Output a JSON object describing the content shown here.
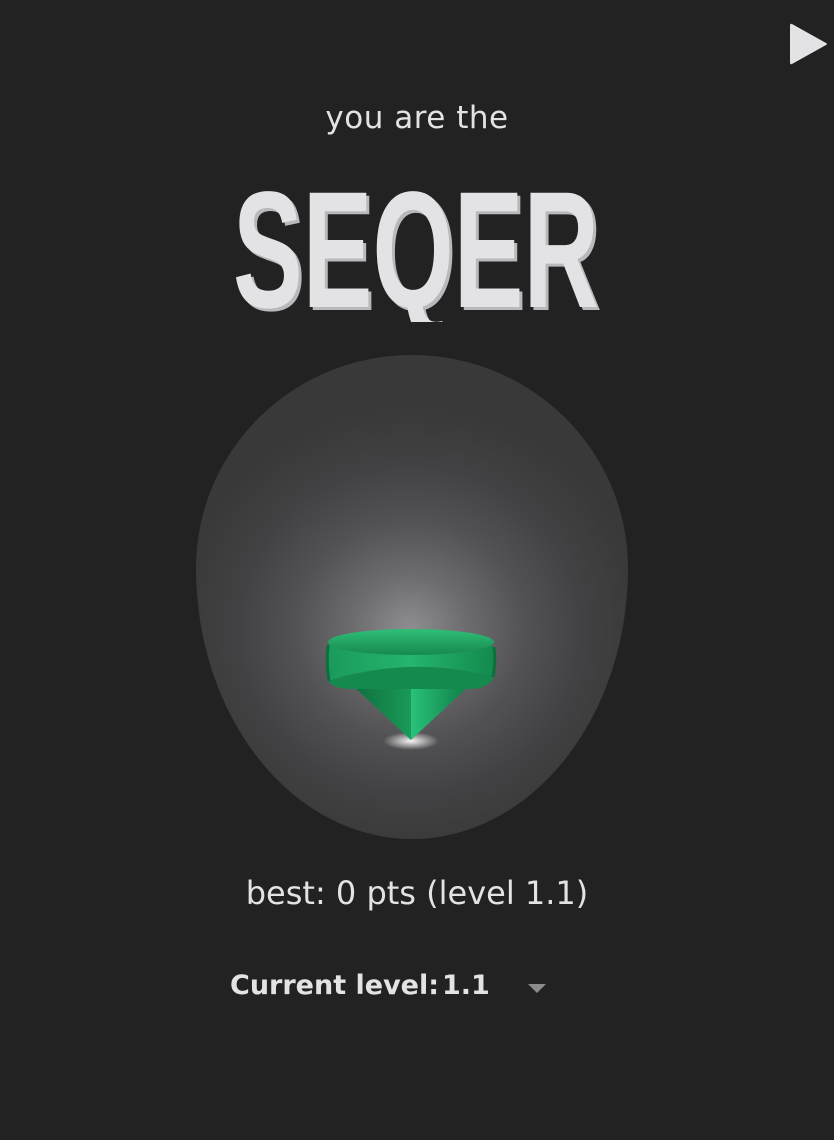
{
  "header": {
    "subtitle": "you are the",
    "title": "SEQER",
    "play_icon": "play-icon"
  },
  "stage": {
    "figure_icon": "spinning-top-icon",
    "figure_color": "#1ea562"
  },
  "stats": {
    "best": "best: 0 pts (level 1.1)"
  },
  "level": {
    "label": "Current level:",
    "selected": "1.1",
    "dropdown_icon": "chevron-down-icon"
  },
  "colors": {
    "background": "#222222",
    "text": "#e3e3e6",
    "accent_green": "#1ea562"
  }
}
